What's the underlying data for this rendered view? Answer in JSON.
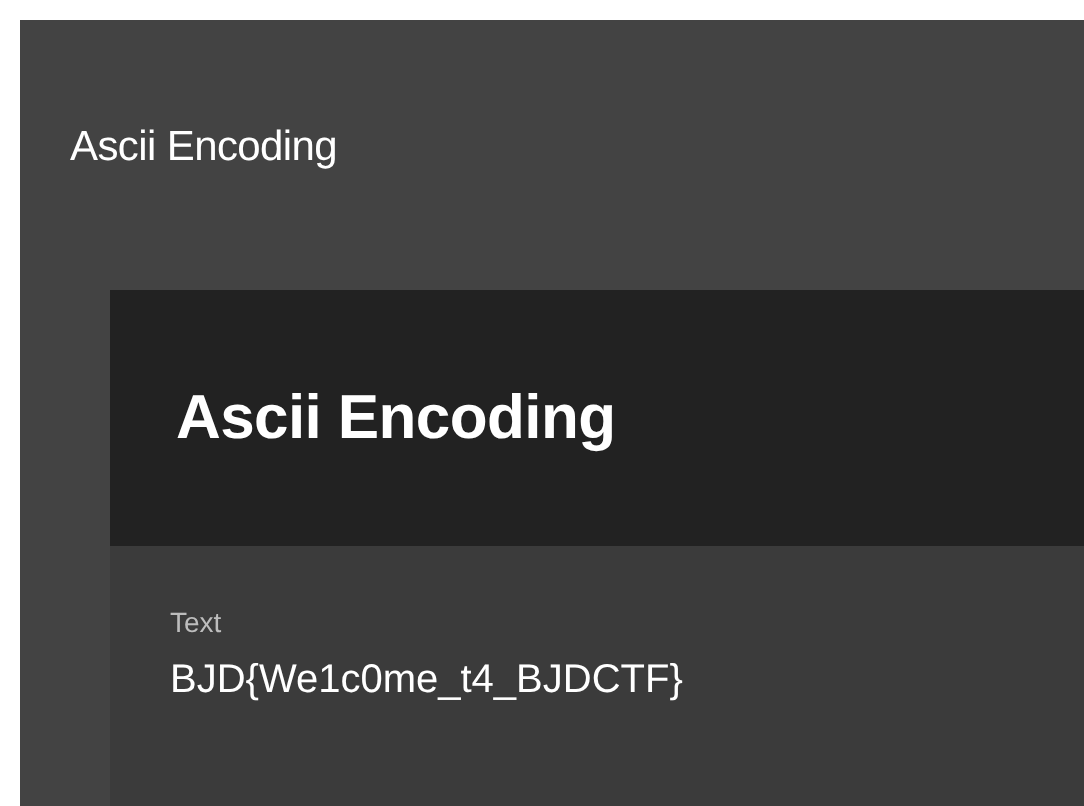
{
  "page": {
    "title": "Ascii Encoding"
  },
  "card": {
    "title": "Ascii Encoding",
    "fields": [
      {
        "label": "Text",
        "value": "BJD{We1c0me_t4_BJDCTF}"
      }
    ]
  }
}
